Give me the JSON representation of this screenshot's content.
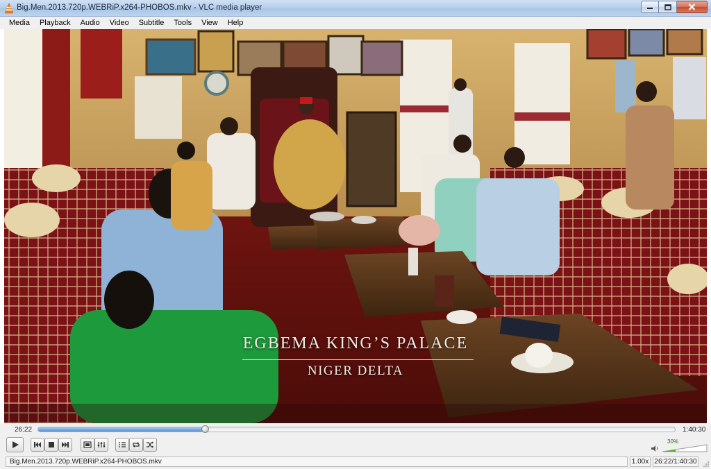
{
  "window": {
    "title": "Big.Men.2013.720p.WEBRiP.x264-PHOBOS.mkv - VLC media player",
    "app_icon": "vlc-cone-icon"
  },
  "menu": [
    "Media",
    "Playback",
    "Audio",
    "Video",
    "Subtitle",
    "Tools",
    "View",
    "Help"
  ],
  "video": {
    "caption_line1": "EGBEMA KING’S PALACE",
    "caption_line2": "NIGER DELTA"
  },
  "playback": {
    "elapsed": "26:22",
    "total": "1:40:30",
    "progress_fraction": 0.2624,
    "state": "paused"
  },
  "volume": {
    "level_label": "30%",
    "level_fraction": 0.3,
    "color": "#4cb51e"
  },
  "status": {
    "filename": "Big.Men.2013.720p.WEBRiP.x264-PHOBOS.mkv",
    "rate": "1.00x",
    "time": "26:22/1:40:30"
  },
  "colors": {
    "seek_fill": "#4f8fd2",
    "titlebar": "#b9d1ec",
    "close_button": "#c74b2c"
  },
  "icons": [
    "play-icon",
    "previous-icon",
    "stop-icon",
    "next-icon",
    "fullscreen-icon",
    "extended-settings-icon",
    "playlist-icon",
    "loop-icon",
    "shuffle-icon",
    "speaker-icon",
    "minimize-icon",
    "maximize-icon",
    "close-icon"
  ]
}
